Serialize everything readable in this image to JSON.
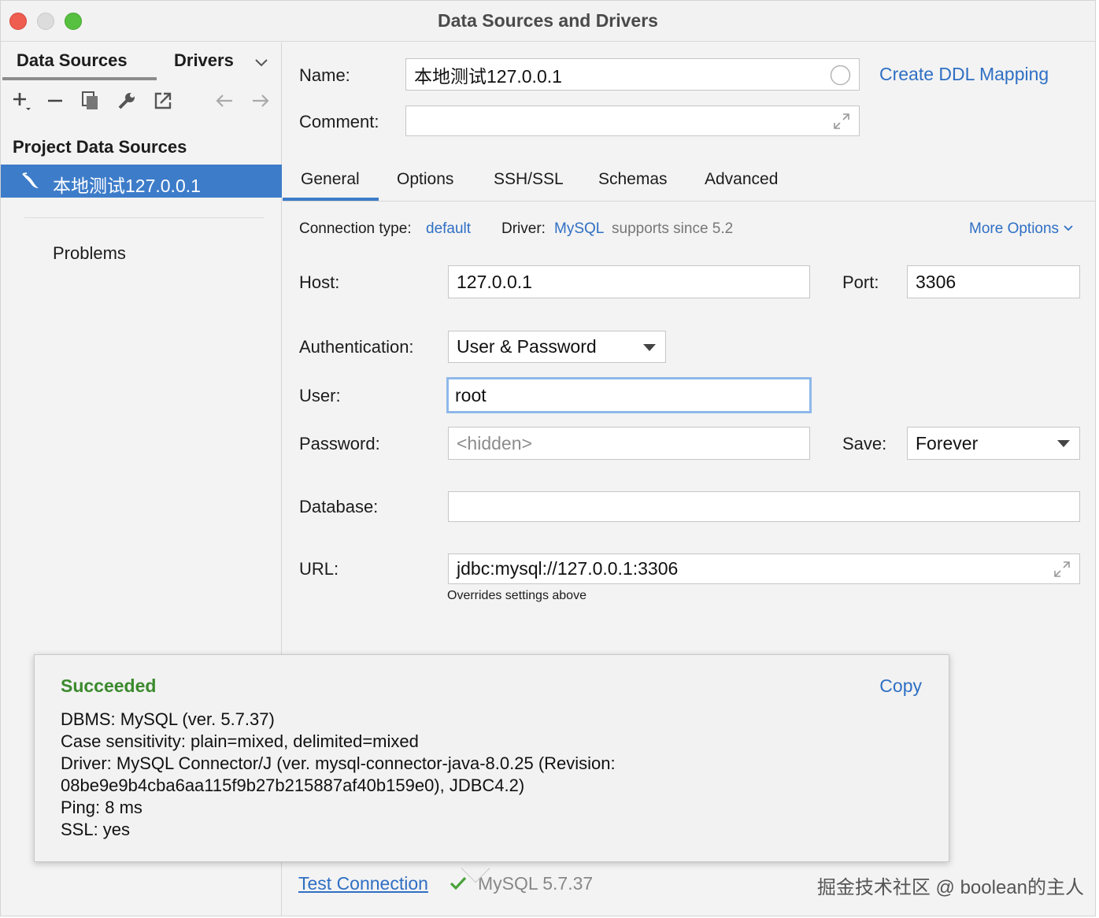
{
  "window": {
    "title": "Data Sources and Drivers"
  },
  "sidebar": {
    "tabs": [
      "Data Sources",
      "Drivers"
    ],
    "toolbar_icons": [
      "add-icon",
      "remove-icon",
      "duplicate-icon",
      "wrench-icon",
      "export-icon",
      "back-arrow-icon",
      "forward-arrow-icon"
    ],
    "section_title": "Project Data Sources",
    "selected_item": "本地测试127.0.0.1",
    "problems": "Problems"
  },
  "form": {
    "name_label": "Name:",
    "name_value": "本地测试127.0.0.1",
    "comment_label": "Comment:",
    "comment_value": "",
    "ddl_link": "Create DDL Mapping",
    "tabs": [
      "General",
      "Options",
      "SSH/SSL",
      "Schemas",
      "Advanced"
    ],
    "active_tab": "General",
    "connection_type_label": "Connection type:",
    "connection_type_value": "default",
    "driver_label": "Driver:",
    "driver_value": "MySQL",
    "driver_note": "supports since 5.2",
    "more_options": "More Options",
    "host_label": "Host:",
    "host_value": "127.0.0.1",
    "port_label": "Port:",
    "port_value": "3306",
    "auth_label": "Authentication:",
    "auth_value": "User & Password",
    "user_label": "User:",
    "user_value": "root",
    "password_label": "Password:",
    "password_placeholder": "<hidden>",
    "save_label": "Save:",
    "save_value": "Forever",
    "database_label": "Database:",
    "database_value": "",
    "url_label": "URL:",
    "url_value": "jdbc:mysql://127.0.0.1:3306",
    "url_note": "Overrides settings above"
  },
  "popup": {
    "status": "Succeeded",
    "copy": "Copy",
    "lines": [
      "DBMS: MySQL (ver. 5.7.37)",
      "Case sensitivity: plain=mixed, delimited=mixed",
      "Driver: MySQL Connector/J (ver. mysql-connector-java-8.0.25 (Revision:",
      "08be9e9b4cba6aa115f9b27b215887af40b159e0), JDBC4.2)",
      "Ping: 8 ms",
      "SSL: yes"
    ]
  },
  "bottom": {
    "test_connection": "Test Connection",
    "version": "MySQL 5.7.37",
    "watermark": "掘金技术社区 @ boolean的主人"
  },
  "colors": {
    "accent": "#3d7cc9",
    "link": "#2f6fc4",
    "success": "#3b8a2d"
  }
}
